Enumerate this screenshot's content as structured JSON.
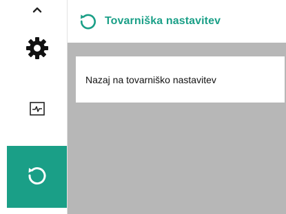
{
  "header": {
    "title": "Tovarniška nastavitev",
    "icon": "restore-icon"
  },
  "sidebar": {
    "items": [
      {
        "name": "scroll-up",
        "icon": "chevron-up-icon"
      },
      {
        "name": "settings",
        "icon": "gear-icon"
      },
      {
        "name": "diagnostics",
        "icon": "pulse-icon"
      },
      {
        "name": "restore",
        "icon": "restore-icon",
        "active": true
      }
    ]
  },
  "main": {
    "menu_items": [
      {
        "label": "Nazaj na tovarniško nastavitev"
      }
    ]
  },
  "colors": {
    "accent": "#1a9f87",
    "content_bg": "#b7b7b7",
    "item_bg": "#ffffff"
  }
}
